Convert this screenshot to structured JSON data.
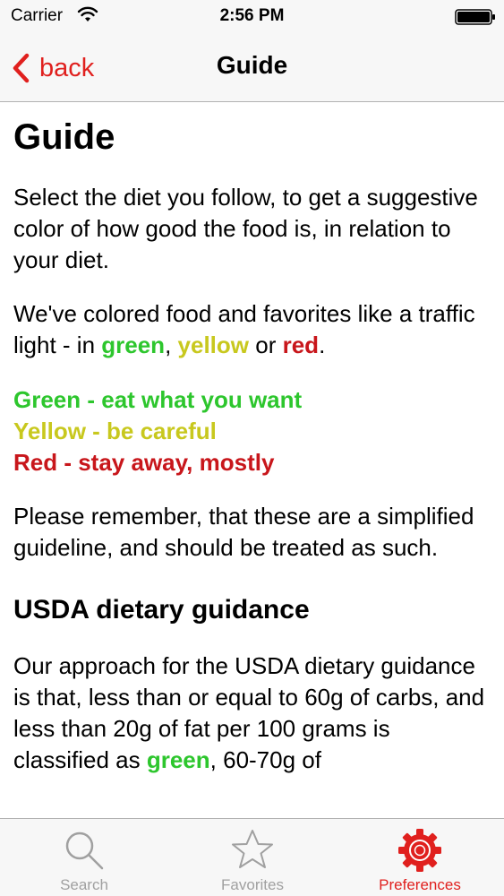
{
  "status_bar": {
    "carrier": "Carrier",
    "time": "2:56 PM"
  },
  "nav": {
    "back_label": "back",
    "title": "Guide"
  },
  "content": {
    "page_title": "Guide",
    "intro": "Select the diet you follow, to get a suggestive color of how good the food is, in relation to your diet.",
    "traffic_prefix": "We've colored food and favorites like a traffic light - in ",
    "traffic_green": "green",
    "traffic_sep1": ", ",
    "traffic_yellow": "yellow",
    "traffic_sep2": " or ",
    "traffic_red": "red",
    "traffic_end": ".",
    "legend_green": "Green - eat what you want",
    "legend_yellow": "Yellow - be careful",
    "legend_red": "Red - stay away, mostly",
    "reminder": "Please remember, that these are a simplified guideline, and should be treated as such.",
    "usda_heading": "USDA dietary guidance",
    "usda_prefix": "Our approach for the USDA dietary guidance is that, less than or equal to 60g of carbs, and less than 20g of fat per 100 grams is classified as ",
    "usda_green": "green",
    "usda_suffix": ", 60-70g of"
  },
  "tabs": [
    {
      "label": "Search",
      "icon": "search-icon",
      "active": false
    },
    {
      "label": "Favorites",
      "icon": "star-icon",
      "active": false
    },
    {
      "label": "Preferences",
      "icon": "gear-icon",
      "active": true
    }
  ],
  "colors": {
    "accent": "#e0201e",
    "green": "#2dc62d",
    "yellow": "#c8c81e",
    "red": "#c8161b",
    "inactive_tab": "#a0a0a0"
  }
}
